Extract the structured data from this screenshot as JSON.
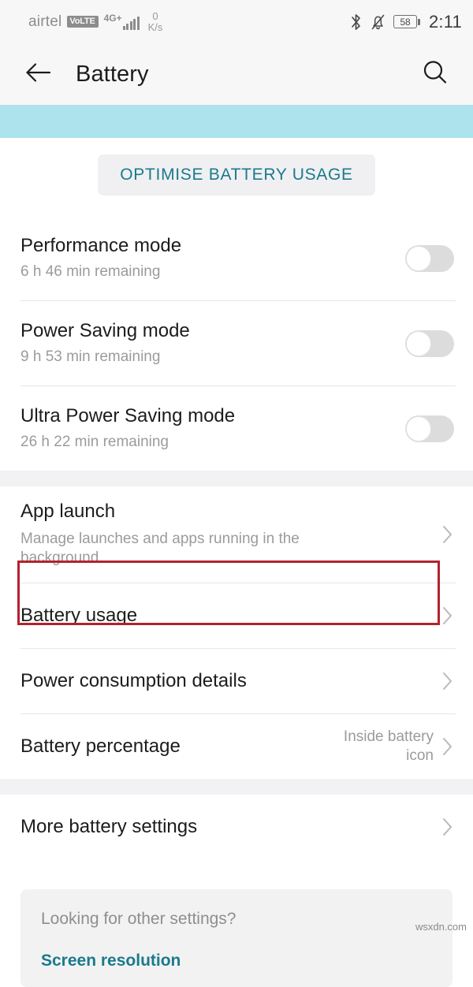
{
  "status_bar": {
    "carrier": "airtel",
    "volte": "VoLTE",
    "network_type": "4G+",
    "net_speed_value": "0",
    "net_speed_unit": "K/s",
    "bluetooth_icon": "bluetooth-icon",
    "silent_icon": "bell-muted-icon",
    "battery_level": "58",
    "time": "2:11"
  },
  "app_bar": {
    "back_icon": "back-arrow-icon",
    "title": "Battery",
    "search_icon": "search-icon"
  },
  "optimise": {
    "label": "OPTIMISE BATTERY USAGE"
  },
  "modes": [
    {
      "title": "Performance mode",
      "subtitle": "6 h 46 min remaining",
      "enabled": false
    },
    {
      "title": "Power Saving mode",
      "subtitle": "9 h 53 min remaining",
      "enabled": false
    },
    {
      "title": "Ultra Power Saving mode",
      "subtitle": "26 h 22 min remaining",
      "enabled": false
    }
  ],
  "settings_group_one": [
    {
      "title": "App launch",
      "subtitle": "Manage launches and apps running in the background.",
      "value": "",
      "highlighted": false
    },
    {
      "title": "Battery usage",
      "subtitle": "",
      "value": "",
      "highlighted": true
    },
    {
      "title": "Power consumption details",
      "subtitle": "",
      "value": "",
      "highlighted": false
    },
    {
      "title": "Battery percentage",
      "subtitle": "",
      "value": "Inside battery icon",
      "highlighted": false
    }
  ],
  "settings_group_two": [
    {
      "title": "More battery settings",
      "subtitle": "",
      "value": "",
      "highlighted": false
    }
  ],
  "other_settings": {
    "question": "Looking for other settings?",
    "link": "Screen resolution"
  },
  "watermark": "wsxdn.com",
  "colors": {
    "accent_teal": "#1A7A8C",
    "blue_band": "#ACE3ED",
    "highlight_red": "#B3222E",
    "section_gray": "#F2F2F4"
  }
}
